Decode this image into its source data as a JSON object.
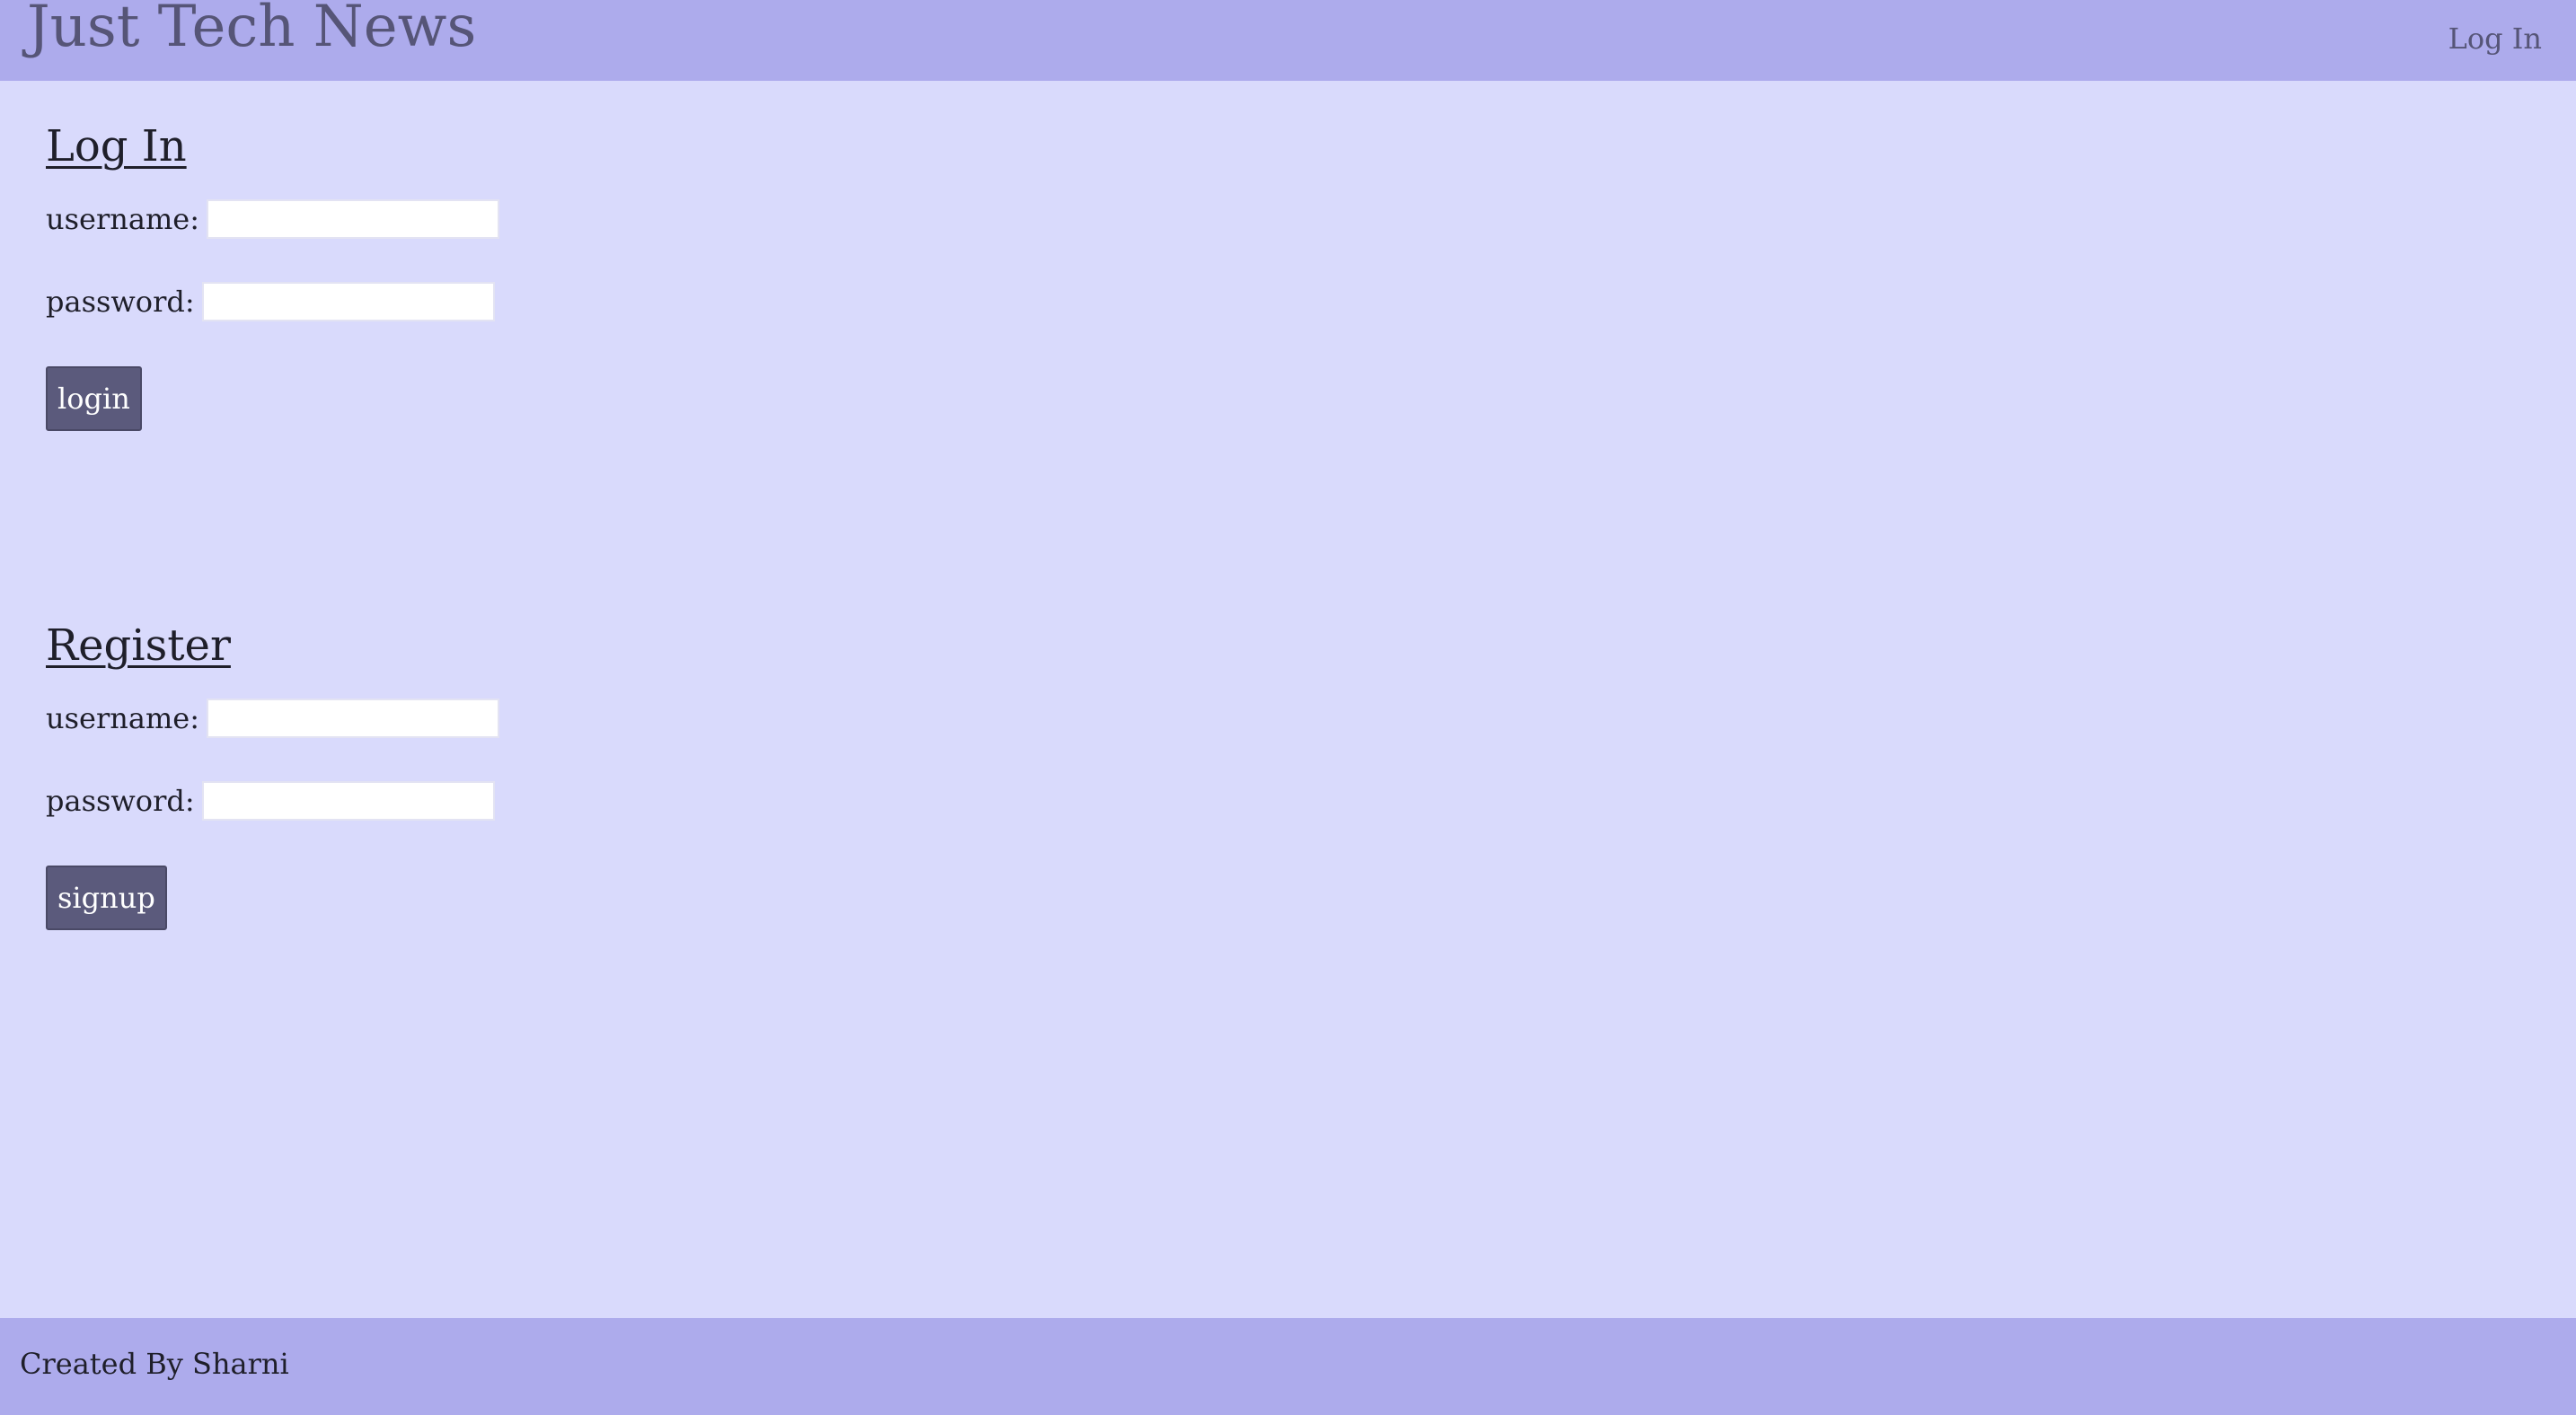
{
  "header": {
    "title": "Just Tech News",
    "nav_login": "Log In"
  },
  "login": {
    "heading": "Log In",
    "username_label": "username:",
    "username_value": "",
    "password_label": "password:",
    "password_value": "",
    "button_label": "login"
  },
  "register": {
    "heading": "Register",
    "username_label": "username:",
    "username_value": "",
    "password_label": "password:",
    "password_value": "",
    "button_label": "signup"
  },
  "footer": {
    "text": "Created By Sharni"
  },
  "colors": {
    "header_bg": "#adabec",
    "page_bg": "#d9dafc",
    "button_bg": "#5b5a7c",
    "title_text": "#565577"
  }
}
